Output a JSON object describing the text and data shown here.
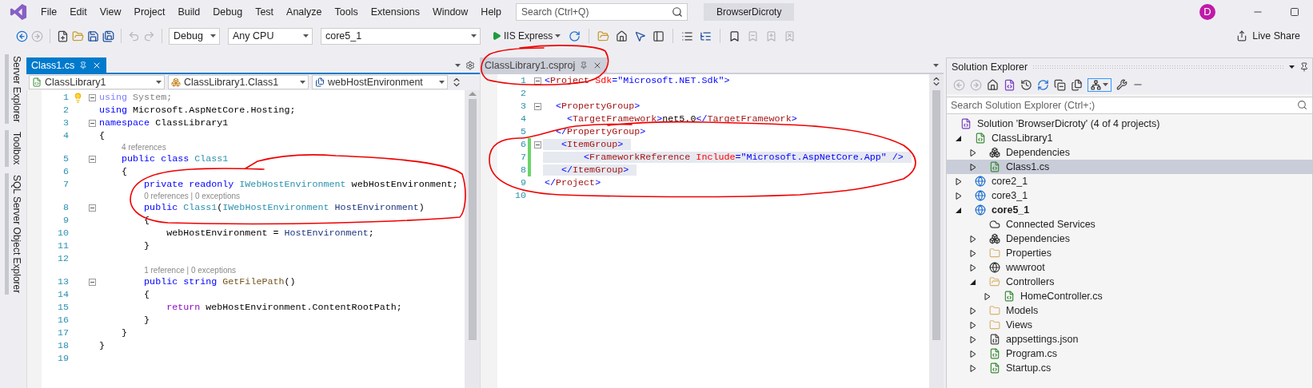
{
  "window": {
    "title": "BrowserDicroty"
  },
  "menu": [
    "File",
    "Edit",
    "View",
    "Project",
    "Build",
    "Debug",
    "Test",
    "Analyze",
    "Tools",
    "Extensions",
    "Window",
    "Help"
  ],
  "search": {
    "placeholder": "Search (Ctrl+Q)"
  },
  "account": {
    "initial": "D"
  },
  "toolbar": {
    "left_tools": [
      {
        "kind": "back",
        "disabled": false
      },
      {
        "kind": "forward",
        "disabled": true
      },
      {
        "kind": "new-item",
        "disabled": false
      },
      {
        "kind": "open",
        "disabled": false
      },
      {
        "kind": "save",
        "disabled": false
      },
      {
        "kind": "save-all",
        "disabled": false
      },
      {
        "kind": "undo",
        "disabled": true
      },
      {
        "kind": "redo",
        "disabled": true
      }
    ],
    "configuration": "Debug",
    "platform": "Any CPU",
    "startup_project": "core5_1",
    "run_target": "IIS Express",
    "right_tools": [
      {
        "kind": "refresh",
        "disabled": false
      },
      {
        "kind": "folder",
        "disabled": false
      },
      {
        "kind": "home",
        "disabled": false
      },
      {
        "kind": "pointer",
        "disabled": false
      },
      {
        "kind": "panel",
        "disabled": false
      },
      {
        "kind": "list",
        "disabled": false
      },
      {
        "kind": "list-tree",
        "disabled": false
      },
      {
        "kind": "bookmark",
        "disabled": false
      },
      {
        "kind": "bookmark-prev",
        "disabled": true
      },
      {
        "kind": "bookmark-next",
        "disabled": true
      },
      {
        "kind": "bookmark-clear",
        "disabled": true
      }
    ],
    "live_share": "Live Share"
  },
  "side_tabs": [
    "Server Explorer",
    "Toolbox",
    "SQL Server Object Explorer"
  ],
  "left_editor": {
    "tab": {
      "label": "Class1.cs",
      "selected": true
    },
    "nav": [
      "ClassLibrary1",
      "ClassLibrary1.Class1",
      "webHostEnvironment"
    ],
    "lines": [
      {
        "kind": "code",
        "n": "1",
        "fold": true,
        "lightbulb": true,
        "tokens": [
          {
            "text": "using",
            "kind": "faded_kw"
          },
          {
            "text": " System;",
            "kind": "faded"
          }
        ]
      },
      {
        "kind": "code",
        "n": "2",
        "tokens": [
          {
            "text": "using",
            "kind": "kw"
          },
          {
            "text": " Microsoft.AspNetCore.Hosting;",
            "kind": "plain"
          }
        ]
      },
      {
        "kind": "code",
        "n": "3",
        "fold": true,
        "tokens": [
          {
            "text": "namespace",
            "kind": "kw"
          },
          {
            "text": " ClassLibrary1",
            "kind": "plain"
          }
        ]
      },
      {
        "kind": "code",
        "n": "4",
        "tokens": [
          {
            "text": "{",
            "kind": "plain"
          }
        ]
      },
      {
        "kind": "codelens",
        "text": "4 references"
      },
      {
        "kind": "code",
        "n": "5",
        "fold": true,
        "tokens": [
          {
            "text": "    public class",
            "kind": "kw"
          },
          {
            "text": " Class1",
            "kind": "type"
          }
        ]
      },
      {
        "kind": "code",
        "n": "6",
        "tokens": [
          {
            "text": "    {",
            "kind": "plain"
          }
        ]
      },
      {
        "kind": "code",
        "n": "7",
        "tokens": [
          {
            "text": "        private readonly",
            "kind": "kw"
          },
          {
            "text": " IWebHostEnvironment",
            "kind": "type"
          },
          {
            "text": " webHostEnvironment;",
            "kind": "plain"
          }
        ]
      },
      {
        "kind": "codelens",
        "text": "0 references | 0 exceptions"
      },
      {
        "kind": "code",
        "n": "8",
        "fold": true,
        "tokens": [
          {
            "text": "        public",
            "kind": "kw"
          },
          {
            "text": " Class1",
            "kind": "type"
          },
          {
            "text": "(",
            "kind": "plain"
          },
          {
            "text": "IWebHostEnvironment",
            "kind": "type"
          },
          {
            "text": " HostEnvironment",
            "kind": "param"
          },
          {
            "text": ")",
            "kind": "plain"
          }
        ]
      },
      {
        "kind": "code",
        "n": "9",
        "tokens": [
          {
            "text": "        {",
            "kind": "plain"
          }
        ]
      },
      {
        "kind": "code",
        "n": "10",
        "tokens": [
          {
            "text": "            webHostEnvironment = ",
            "kind": "plain"
          },
          {
            "text": "HostEnvironment",
            "kind": "param"
          },
          {
            "text": ";",
            "kind": "plain"
          }
        ]
      },
      {
        "kind": "code",
        "n": "11",
        "tokens": [
          {
            "text": "        }",
            "kind": "plain"
          }
        ]
      },
      {
        "kind": "code",
        "n": "12"
      },
      {
        "kind": "codelens",
        "text": "1 reference | 0 exceptions"
      },
      {
        "kind": "code",
        "n": "13",
        "fold": true,
        "tokens": [
          {
            "text": "        public string",
            "kind": "kw"
          },
          {
            "text": " GetFilePath",
            "kind": "method"
          },
          {
            "text": "()",
            "kind": "plain"
          }
        ]
      },
      {
        "kind": "code",
        "n": "14",
        "tokens": [
          {
            "text": "        {",
            "kind": "plain"
          }
        ]
      },
      {
        "kind": "code",
        "n": "15",
        "tokens": [
          {
            "text": "            return",
            "kind": "ctrl"
          },
          {
            "text": " webHostEnvironment.ContentRootPath;",
            "kind": "plain"
          }
        ]
      },
      {
        "kind": "code",
        "n": "16",
        "tokens": [
          {
            "text": "        }",
            "kind": "plain"
          }
        ]
      },
      {
        "kind": "code",
        "n": "17",
        "tokens": [
          {
            "text": "    }",
            "kind": "plain"
          }
        ]
      },
      {
        "kind": "code",
        "n": "18",
        "tokens": [
          {
            "text": "}",
            "kind": "plain"
          }
        ]
      },
      {
        "kind": "code",
        "n": "19"
      }
    ]
  },
  "right_editor": {
    "tab": {
      "label": "ClassLibrary1.csproj",
      "selected": false
    },
    "lines": [
      {
        "kind": "code",
        "n": "1",
        "fold": true,
        "tokens": [
          {
            "text": "<",
            "kind": "delim"
          },
          {
            "text": "Project",
            "kind": "tag"
          },
          {
            "text": " Sdk",
            "kind": "attr"
          },
          {
            "text": "=\"Microsoft.NET.Sdk\">",
            "kind": "delim"
          }
        ]
      },
      {
        "kind": "code",
        "n": "2"
      },
      {
        "kind": "code",
        "n": "3",
        "fold": true,
        "tokens": [
          {
            "text": "  <",
            "kind": "delim"
          },
          {
            "text": "PropertyGroup",
            "kind": "tag"
          },
          {
            "text": ">",
            "kind": "delim"
          }
        ]
      },
      {
        "kind": "code",
        "n": "4",
        "tokens": [
          {
            "text": "    <",
            "kind": "delim"
          },
          {
            "text": "TargetFramework",
            "kind": "tag"
          },
          {
            "text": ">",
            "kind": "delim"
          },
          {
            "text": "net5.0",
            "kind": "plain"
          },
          {
            "text": "</",
            "kind": "delim"
          },
          {
            "text": "TargetFramework",
            "kind": "tag"
          },
          {
            "text": ">",
            "kind": "delim"
          }
        ]
      },
      {
        "kind": "code",
        "n": "5",
        "tokens": [
          {
            "text": "  </",
            "kind": "delim"
          },
          {
            "text": "PropertyGroup",
            "kind": "tag"
          },
          {
            "text": ">",
            "kind": "delim"
          }
        ]
      },
      {
        "kind": "code",
        "n": "6",
        "fold": true,
        "changed": true,
        "highlighted": true,
        "tokens": [
          {
            "text": "   <",
            "kind": "delim"
          },
          {
            "text": "ItemGroup",
            "kind": "tag"
          },
          {
            "text": ">",
            "kind": "delim"
          }
        ]
      },
      {
        "kind": "code",
        "n": "7",
        "changed": true,
        "highlighted": true,
        "tokens": [
          {
            "text": "       <",
            "kind": "delim"
          },
          {
            "text": "FrameworkReference",
            "kind": "tag"
          },
          {
            "text": " Include",
            "kind": "attr"
          },
          {
            "text": "=\"Microsoft.AspNetCore.App\" />",
            "kind": "delim"
          }
        ]
      },
      {
        "kind": "code",
        "n": "8",
        "changed": true,
        "highlighted": true,
        "tokens": [
          {
            "text": "   </",
            "kind": "delim"
          },
          {
            "text": "ItemGroup",
            "kind": "tag"
          },
          {
            "text": ">",
            "kind": "delim"
          }
        ]
      },
      {
        "kind": "code",
        "n": "9",
        "tokens": [
          {
            "text": "</",
            "kind": "delim"
          },
          {
            "text": "Project",
            "kind": "tag"
          },
          {
            "text": ">",
            "kind": "delim"
          }
        ]
      },
      {
        "kind": "code",
        "n": "10"
      }
    ]
  },
  "solution_explorer": {
    "title": "Solution Explorer",
    "toolbar": [
      {
        "kind": "back",
        "disabled": true
      },
      {
        "kind": "forward",
        "disabled": true
      },
      {
        "kind": "home",
        "disabled": false
      },
      {
        "kind": "switch-views",
        "disabled": false
      },
      {
        "kind": "history",
        "disabled": false
      },
      {
        "kind": "sync",
        "disabled": false
      },
      {
        "kind": "collapse",
        "disabled": false
      },
      {
        "kind": "copy",
        "disabled": false
      }
    ],
    "sync_toggle": {
      "on": true
    },
    "search": {
      "placeholder": "Search Solution Explorer (Ctrl+;)"
    },
    "tree": [
      {
        "label": "Solution 'BrowserDicroty' (4 of 4 projects)",
        "kind": "solution",
        "selected": false,
        "children": [
          {
            "label": "ClassLibrary1",
            "kind": "csproj",
            "expanded": true,
            "selected": false,
            "children": [
              {
                "label": "Dependencies",
                "kind": "deps",
                "expanded": false,
                "selected": false
              },
              {
                "label": "Class1.cs",
                "kind": "cs",
                "expanded": false,
                "selected": true
              }
            ]
          },
          {
            "label": "core2_1",
            "kind": "webproj",
            "expanded": false,
            "selected": false
          },
          {
            "label": "core3_1",
            "kind": "webproj",
            "expanded": false,
            "selected": false
          },
          {
            "label": "core5_1",
            "kind": "webproj",
            "expanded": true,
            "bold": true,
            "selected": false,
            "children": [
              {
                "label": "Connected Services",
                "kind": "service",
                "selected": false
              },
              {
                "label": "Dependencies",
                "kind": "deps",
                "expanded": false,
                "selected": false
              },
              {
                "label": "Properties",
                "kind": "props",
                "expanded": false,
                "selected": false
              },
              {
                "label": "wwwroot",
                "kind": "globe",
                "expanded": false,
                "selected": false
              },
              {
                "label": "Controllers",
                "kind": "folder",
                "expanded": true,
                "selected": false,
                "children": [
                  {
                    "label": "HomeController.cs",
                    "kind": "cs",
                    "expanded": false,
                    "selected": false
                  }
                ]
              },
              {
                "label": "Models",
                "kind": "folder",
                "expanded": false,
                "selected": false
              },
              {
                "label": "Views",
                "kind": "folder",
                "expanded": false,
                "selected": false
              },
              {
                "label": "appsettings.json",
                "kind": "json",
                "expanded": false,
                "selected": false
              },
              {
                "label": "Program.cs",
                "kind": "cs",
                "expanded": false,
                "selected": false
              },
              {
                "label": "Startup.cs",
                "kind": "cs",
                "expanded": false,
                "selected": false
              }
            ]
          }
        ]
      }
    ]
  }
}
